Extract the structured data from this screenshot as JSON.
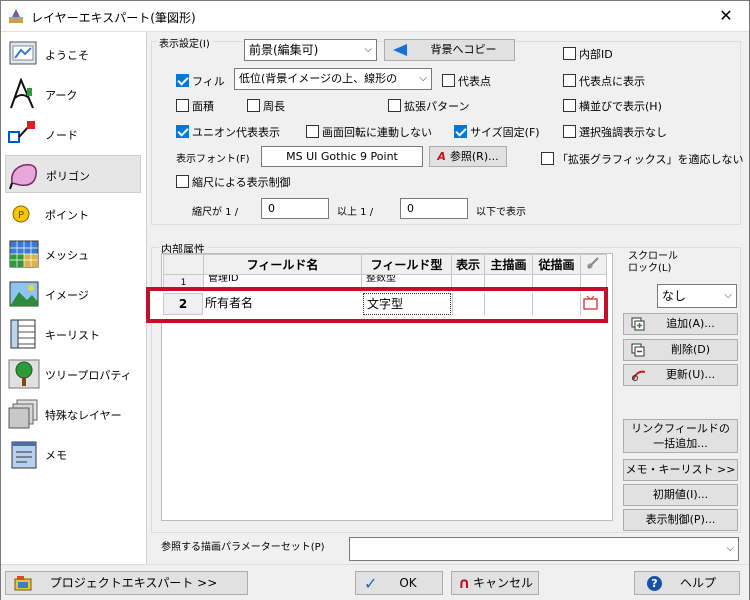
{
  "window": {
    "title": "レイヤーエキスパート(筆図形)",
    "close": "✕"
  },
  "sidebar": {
    "items": [
      {
        "label": "ようこそ",
        "icon": "welcome-icon"
      },
      {
        "label": "アーク",
        "icon": "arc-icon"
      },
      {
        "label": "ノード",
        "icon": "node-icon"
      },
      {
        "label": "ポリゴン",
        "icon": "polygon-icon",
        "selected": true
      },
      {
        "label": "ポイント",
        "icon": "point-icon"
      },
      {
        "label": "メッシュ",
        "icon": "mesh-icon"
      },
      {
        "label": "イメージ",
        "icon": "image-icon"
      },
      {
        "label": "キーリスト",
        "icon": "keylist-icon"
      },
      {
        "label": "ツリープロパティ",
        "icon": "tree-icon"
      },
      {
        "label": "特殊なレイヤー",
        "icon": "special-layer-icon"
      },
      {
        "label": "メモ",
        "icon": "memo-icon"
      }
    ]
  },
  "display": {
    "section_label": "表示設定(I)",
    "background_select": "前景(編集可)",
    "copy_to_background": "背景へコピー",
    "internal_id": "内部ID",
    "fill": "フィル",
    "fill_mode": "低位(背景イメージの上、線形の",
    "representative_point": "代表点",
    "show_at_rep_point": "代表点に表示",
    "area": "面積",
    "perimeter": "周長",
    "extended_pattern": "拡張パターン",
    "horizontal_display": "横並びで表示(H)",
    "union_display": "ユニオン代表表示",
    "no_rotation": "画面回転に連動しない",
    "size_fixed": "サイズ固定(F)",
    "selection_highlight": "選択強調表示なし",
    "font_label": "表示フォント(F)",
    "font_value": "MS UI Gothic 9 Point",
    "font_ref": "参照(R)...",
    "apply_extended_graphics": "「拡張グラフィックス」を適応しない",
    "scale_control": "縮尺による表示制御",
    "scale_label": "縮尺が 1 /",
    "scale_min": "0",
    "above": "以上 1 /",
    "scale_max": "0",
    "below": "以下で表示"
  },
  "attributes": {
    "section_label": "内部属性",
    "headers": [
      "フィールド名",
      "フィールド型",
      "表示",
      "主描画",
      "従描画"
    ],
    "rows": [
      {
        "num": "1",
        "name": "管理ID",
        "type": "整数型"
      },
      {
        "num": "2",
        "name": "所有者名",
        "type": "文字型"
      }
    ],
    "scroll_lock_label": "スクロール\nロック(L)",
    "scroll_lock_value": "なし",
    "add": "追加(A)...",
    "delete": "削除(D)",
    "update": "更新(U)...",
    "bulk_add_link": "リンクフィールドの\n一括追加...",
    "memo_keylist": "メモ・キーリスト >>",
    "initial_value": "初期値(I)...",
    "display_control": "表示制御(P)..."
  },
  "params": {
    "label": "参照する描画パラメーターセット(P)",
    "value": ""
  },
  "footer": {
    "project_expert": "プロジェクトエキスパート >>",
    "ok": "OK",
    "cancel": "キャンセル",
    "help": "ヘルプ"
  },
  "colors": {
    "accent": "#0078d7",
    "highlight": "#c0102a"
  }
}
